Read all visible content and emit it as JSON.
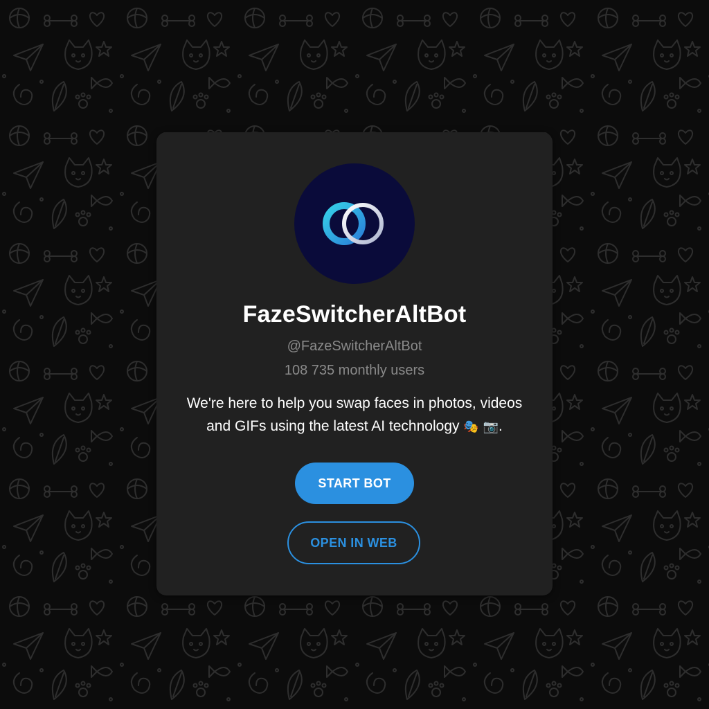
{
  "bot": {
    "name": "FazeSwitcherAltBot",
    "username": "@FazeSwitcherAltBot",
    "monthly_users": "108 735 monthly users",
    "description_line1": "We're here to help you swap faces in photos, videos",
    "description_line2": "and GIFs using the latest AI technology",
    "emoji_masks": "🎭",
    "emoji_camera": "📷",
    "description_end": "."
  },
  "buttons": {
    "start_label": "START BOT",
    "web_label": "OPEN IN WEB"
  },
  "colors": {
    "accent": "#2b90e0",
    "card_bg": "#212121",
    "avatar_bg": "#0a0b3a",
    "page_bg": "#0c0c0c"
  },
  "icons": {
    "avatar": "interlocking-rings-logo-icon",
    "wallpaper": "doodle-pattern"
  }
}
